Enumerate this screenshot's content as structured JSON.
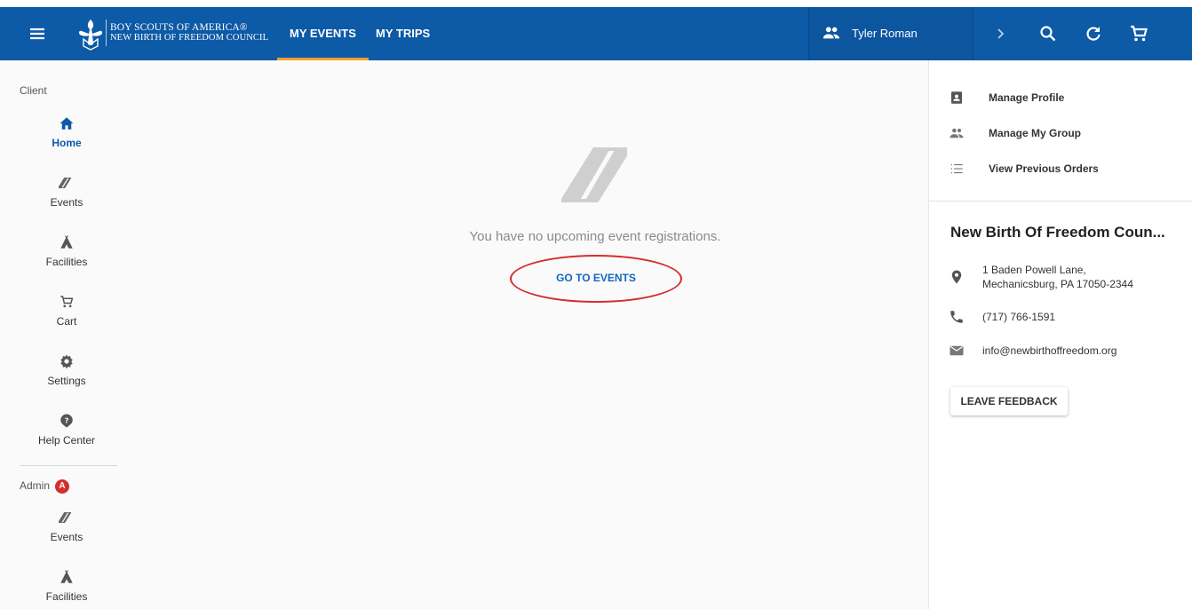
{
  "header": {
    "org_line1": "BOY SCOUTS OF AMERICA®",
    "org_line2": "NEW BIRTH OF FREEDOM COUNCIL",
    "tabs": [
      {
        "label": "MY EVENTS",
        "active": true
      },
      {
        "label": "MY TRIPS",
        "active": false
      }
    ],
    "user_name": "Tyler Roman",
    "brand_color": "#0d5aa7",
    "tab_indicator_color": "#f0a030"
  },
  "sidebar": {
    "client_label": "Client",
    "client_items": [
      {
        "label": "Home",
        "icon": "home-icon",
        "selected": true
      },
      {
        "label": "Events",
        "icon": "ticket-icon"
      },
      {
        "label": "Facilities",
        "icon": "tent-icon"
      },
      {
        "label": "Cart",
        "icon": "cart-icon"
      },
      {
        "label": "Settings",
        "icon": "gear-icon"
      },
      {
        "label": "Help Center",
        "icon": "help-icon"
      }
    ],
    "admin_label": "Admin",
    "admin_badge": "A",
    "admin_items": [
      {
        "label": "Events",
        "icon": "ticket-icon"
      },
      {
        "label": "Facilities",
        "icon": "tent-icon"
      }
    ]
  },
  "main": {
    "empty_message": "You have no upcoming event registrations.",
    "go_to_events_label": "GO TO EVENTS"
  },
  "right_panel": {
    "links": [
      {
        "label": "Manage Profile",
        "icon": "profile-icon"
      },
      {
        "label": "Manage My Group",
        "icon": "group-icon"
      },
      {
        "label": "View Previous Orders",
        "icon": "list-icon"
      }
    ],
    "council_name": "New Birth Of Freedom Coun...",
    "address_line1": "1 Baden Powell Lane,",
    "address_line2": "Mechanicsburg, PA 17050-2344",
    "phone": "(717) 766-1591",
    "email": "info@newbirthoffreedom.org",
    "feedback_label": "LEAVE FEEDBACK"
  }
}
